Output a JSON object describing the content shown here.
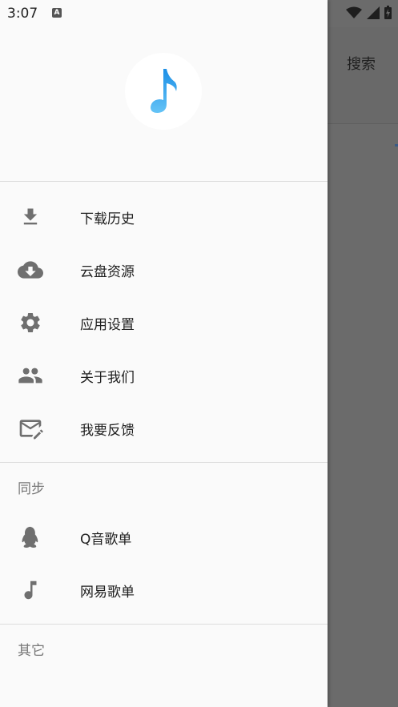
{
  "status": {
    "time": "3:07",
    "notif_badge": "A"
  },
  "underlay": {
    "search_label": "搜索"
  },
  "drawer": {
    "logo_icon": "music-note-icon",
    "primary_items": [
      {
        "label": "下载历史",
        "icon": "download-icon"
      },
      {
        "label": "云盘资源",
        "icon": "cloud-download-icon"
      },
      {
        "label": "应用设置",
        "icon": "gear-icon"
      },
      {
        "label": "关于我们",
        "icon": "people-icon"
      },
      {
        "label": "我要反馈",
        "icon": "feedback-mail-icon"
      }
    ],
    "sync_title": "同步",
    "sync_items": [
      {
        "label": "Q音歌单",
        "icon": "penguin-icon"
      },
      {
        "label": "网易歌单",
        "icon": "music-note-icon"
      }
    ],
    "other_title": "其它"
  },
  "colors": {
    "icon_gray": "#6f6f6f",
    "logo_blue": "#3aa0e8",
    "scrim": "#6b6b6b"
  }
}
